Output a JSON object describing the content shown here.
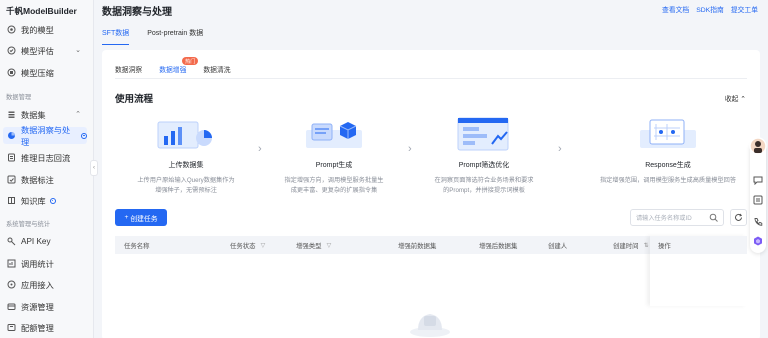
{
  "brand": "千帆ModelBuilder",
  "sidebar": {
    "items": [
      {
        "label": "我的模型",
        "icon": "model-icon"
      },
      {
        "label": "模型评估",
        "icon": "eval-icon",
        "has_chevron": true
      },
      {
        "label": "模型压缩",
        "icon": "compress-icon"
      },
      {
        "label": "数据集",
        "icon": "dataset-icon",
        "has_chevron": true
      },
      {
        "label": "数据洞察与处理",
        "icon": "insight-icon",
        "active": true
      },
      {
        "label": "推理日志回流",
        "icon": "log-icon"
      },
      {
        "label": "数据标注",
        "icon": "label-icon"
      },
      {
        "label": "知识库",
        "icon": "knowledge-icon"
      },
      {
        "label": "API Key",
        "icon": "key-icon"
      },
      {
        "label": "调用统计",
        "icon": "stats-icon"
      },
      {
        "label": "应用接入",
        "icon": "app-icon"
      },
      {
        "label": "资源管理",
        "icon": "resource-icon"
      },
      {
        "label": "配额管理",
        "icon": "quota-icon"
      }
    ],
    "groups": {
      "data": "数据管理",
      "system": "系统管理与统计"
    }
  },
  "header": {
    "title": "数据洞察与处理",
    "links": [
      "查看文档",
      "SDK指南",
      "提交工单"
    ]
  },
  "main_tabs": [
    "SFT数据",
    "Post-pretrain 数据"
  ],
  "sub_tabs": [
    "数据洞察",
    "数据增强",
    "数据清洗"
  ],
  "hot_badge": "热门",
  "section": {
    "title": "使用流程",
    "collapse": "收起"
  },
  "steps": [
    {
      "title": "上传数据集",
      "desc1": "上传用户原始输入Query数据集作为",
      "desc2": "增强种子，无需预标注"
    },
    {
      "title": "Prompt生成",
      "desc1": "指定增强方向，调用模型服务批量生",
      "desc2": "成更丰富、更复杂的扩展指令集"
    },
    {
      "title": "Prompt筛选优化",
      "desc1": "在洞察页面筛选符合业务场景和要求",
      "desc2": "的Prompt，并拼接提示词模板"
    },
    {
      "title": "Response生成",
      "desc1": "指定增强范围，调用模型服务生成高质量模型回答",
      "desc2": ""
    }
  ],
  "actions": {
    "create": "创建任务",
    "search_placeholder": "请输入任务名称或ID"
  },
  "table": {
    "columns": [
      "任务名称",
      "任务状态",
      "增强类型",
      "增强前数据集",
      "增强后数据集",
      "创建人",
      "创建时间",
      "操作"
    ]
  },
  "colors": {
    "accent": "#2468f2",
    "badge": "#f36a4c"
  }
}
